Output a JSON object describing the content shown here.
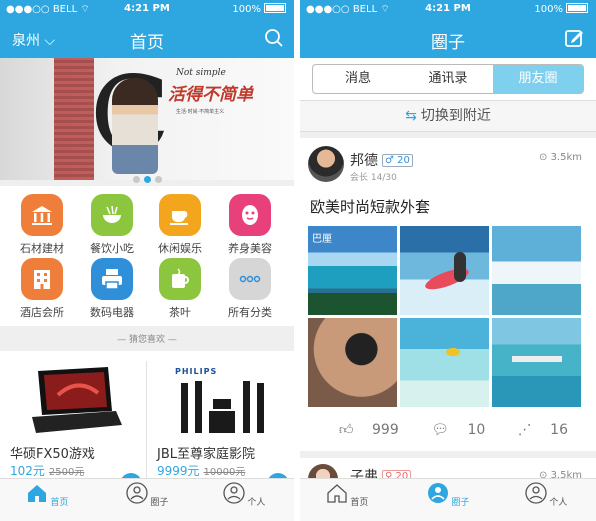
{
  "status": {
    "carrier": "BELL",
    "time": "4:21 PM",
    "battery": "100%"
  },
  "left": {
    "title": "首页",
    "city": "泉州",
    "banner": {
      "not_simple": "Not simple",
      "slogan": "活得不简单",
      "small": "生活·时尚·不简单主义"
    },
    "categories": [
      {
        "label": "石材建材",
        "color": "#f07e3b",
        "icon": "bank-icon"
      },
      {
        "label": "餐饮小吃",
        "color": "#8cc63e",
        "icon": "bowl-icon"
      },
      {
        "label": "休闲娱乐",
        "color": "#f2a51d",
        "icon": "coffee-icon"
      },
      {
        "label": "养身美容",
        "color": "#e8407a",
        "icon": "face-mask-icon"
      },
      {
        "label": "酒店会所",
        "color": "#f07e3b",
        "icon": "building-icon"
      },
      {
        "label": "数码电器",
        "color": "#2f8fd8",
        "icon": "printer-icon"
      },
      {
        "label": "茶叶",
        "color": "#8cc63e",
        "icon": "tea-icon"
      },
      {
        "label": "所有分类",
        "color": "#d6d6d6",
        "icon": "more-icon"
      }
    ],
    "section_label": "猜您喜欢",
    "products": [
      {
        "name": "华硕FX50游戏",
        "price": "102元",
        "old_price": "2500元"
      },
      {
        "name": "JBL至尊家庭影院",
        "price": "9999元",
        "old_price": "10000元",
        "brand": "PHILIPS"
      }
    ]
  },
  "right": {
    "title": "圈子",
    "segments": [
      "消息",
      "通讯录",
      "朋友圈"
    ],
    "switch_label": "切换到附近",
    "post": {
      "user": "邦德",
      "age": "20",
      "sub": "会长 14/30",
      "distance": "3.5km",
      "text": "欧美时尚短款外套",
      "photo_caption": "巴厘",
      "likes": "999",
      "comments": "10",
      "shares": "16"
    },
    "post2": {
      "user": "子弗",
      "age": "20",
      "distance": "3.5km"
    }
  },
  "tabs": [
    "首页",
    "圈子",
    "个人"
  ],
  "colors": {
    "accent": "#2ea7e0"
  }
}
